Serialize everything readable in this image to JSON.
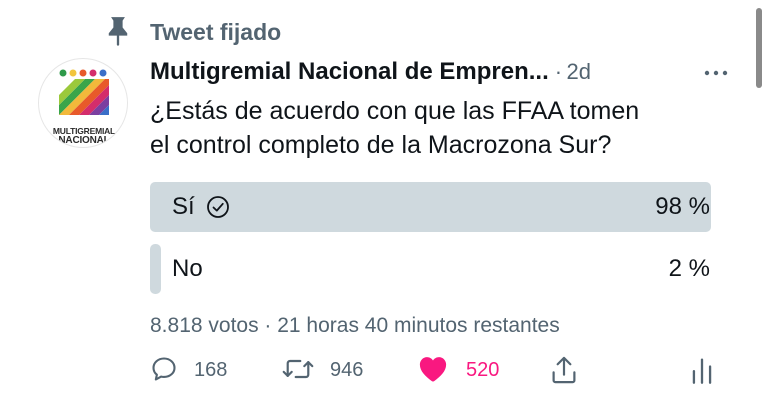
{
  "pinned": {
    "label": "Tweet fijado",
    "icon": "pin-icon"
  },
  "author": {
    "name": "Multigremial Nacional de Empren...",
    "separator": "·",
    "time": "2d",
    "avatar_logo_lines": [
      "MULTIGREMIAL",
      "NACIONAL"
    ]
  },
  "tweet": {
    "text_line1": "¿Estás de acuerdo con que las FFAA tomen",
    "text_line2": "el control completo de la Macrozona Sur?"
  },
  "poll": {
    "options": [
      {
        "label": "Sí",
        "percent_text": "98 %",
        "value": 0.98,
        "selected": true
      },
      {
        "label": "No",
        "percent_text": "2 %",
        "value": 0.02,
        "selected": false
      }
    ],
    "meta": "8.818 votos · 21 horas 40 minutos restantes"
  },
  "actions": {
    "reply_count": "168",
    "retweet_count": "946",
    "like_count": "520"
  },
  "colors": {
    "poll_fill": "#cfd9de",
    "like_pink": "#f91880",
    "secondary_text": "#536471"
  }
}
